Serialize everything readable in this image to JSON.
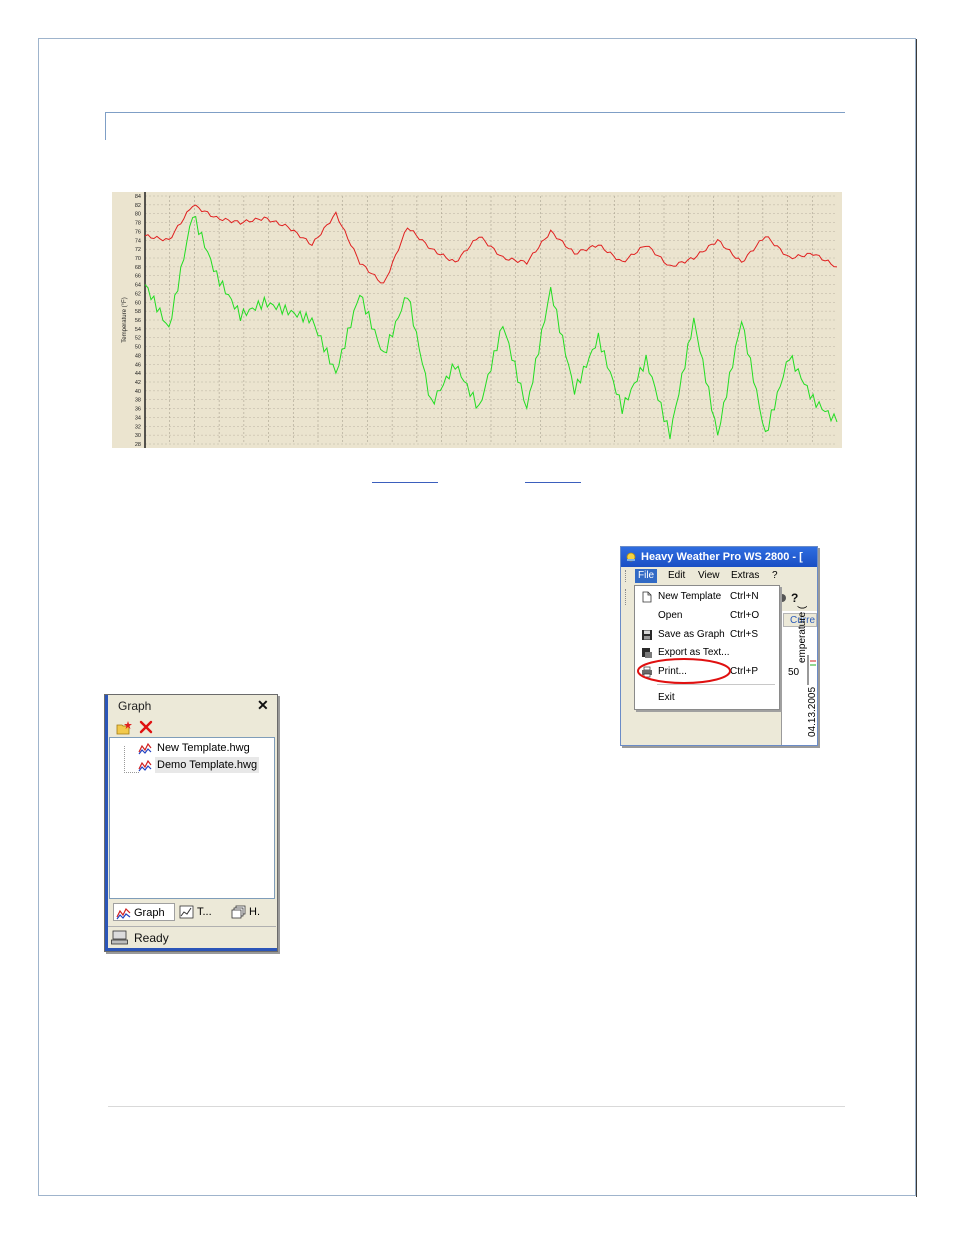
{
  "chart_data": {
    "type": "line",
    "title": "",
    "xlabel": "",
    "ylabel": "Temperature (°F)",
    "ylim": [
      28,
      84
    ],
    "yticks": [
      84,
      82,
      80,
      78,
      76,
      74,
      72,
      70,
      68,
      66,
      64,
      62,
      60,
      58,
      56,
      54,
      52,
      50,
      48,
      46,
      44,
      42,
      40,
      38,
      36,
      34,
      32,
      30,
      28
    ],
    "grid": true,
    "x_count": 30,
    "series": [
      {
        "name": "",
        "color": "#e02020",
        "values": [
          75,
          74,
          82,
          79,
          78,
          79,
          77,
          73,
          80,
          69,
          64,
          77,
          72,
          69,
          75,
          70,
          69,
          76,
          71,
          73,
          69,
          73,
          68,
          70,
          74,
          69,
          75,
          70,
          71,
          68
        ]
      },
      {
        "name": "",
        "color": "#22dd22",
        "values": [
          64,
          54,
          80,
          66,
          57,
          60,
          58,
          56,
          44,
          62,
          48,
          62,
          37,
          46,
          36,
          55,
          36,
          63,
          40,
          52,
          36,
          47,
          30,
          56,
          30,
          56,
          30,
          48,
          38,
          33
        ]
      }
    ]
  },
  "heavy_weather": {
    "title": "Heavy Weather Pro WS 2800 - [",
    "menu": [
      "File",
      "Edit",
      "View",
      "Extras",
      "?"
    ],
    "file_menu": [
      {
        "label": "New Template",
        "shortcut": "Ctrl+N",
        "icon": "new-document-icon"
      },
      {
        "label": "Open",
        "shortcut": "Ctrl+O",
        "icon": ""
      },
      {
        "label": "Save as Graph",
        "shortcut": "Ctrl+S",
        "icon": "floppy-disk-icon"
      },
      {
        "label": "Export as Text...",
        "shortcut": "",
        "icon": "export-icon"
      },
      {
        "label": "Print...",
        "shortcut": "Ctrl+P",
        "icon": "printer-icon"
      },
      {
        "label": "Exit",
        "shortcut": "",
        "icon": ""
      }
    ],
    "curr_tab": "Curre",
    "axis_value": "50",
    "axis_label": "emperature (",
    "date_label": "04.13.2005"
  },
  "graph_panel": {
    "title": "Graph",
    "close": "✕",
    "templates": [
      "New Template.hwg",
      "Demo Template.hwg"
    ],
    "tabs": [
      "Graph",
      "T...",
      "H."
    ],
    "status": "Ready"
  },
  "colors": {
    "accent_blue": "#2b55b8",
    "highlight_red": "#e01010",
    "chart_background": "#ebe4cf"
  }
}
